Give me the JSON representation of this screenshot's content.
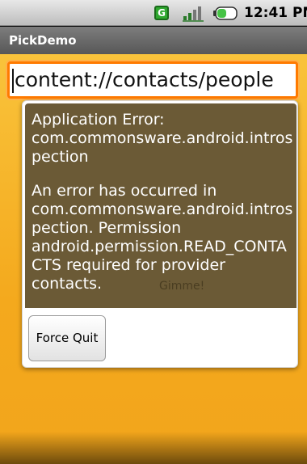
{
  "status_bar": {
    "notification_icon": "G",
    "time": "12:41 PM",
    "icons": [
      "g-notification-icon",
      "signal-icon",
      "battery-icon"
    ]
  },
  "title_bar": {
    "title": "PickDemo"
  },
  "main": {
    "url_field": {
      "value": "content://contacts/people"
    },
    "behind_button_label": "Gimme!"
  },
  "dialog": {
    "title": "Application Error: com.commonsware.android.introspection",
    "message": "An error has occurred in com.commonsware.android.introspection.  Permission android.permission.READ_CONTACTS required for provider contacts.",
    "button_label": "Force Quit"
  },
  "colors": {
    "accent_orange": "#ff7a00",
    "background_yellow": "#f4a91d",
    "dialog_brown": "#6b5a36"
  }
}
